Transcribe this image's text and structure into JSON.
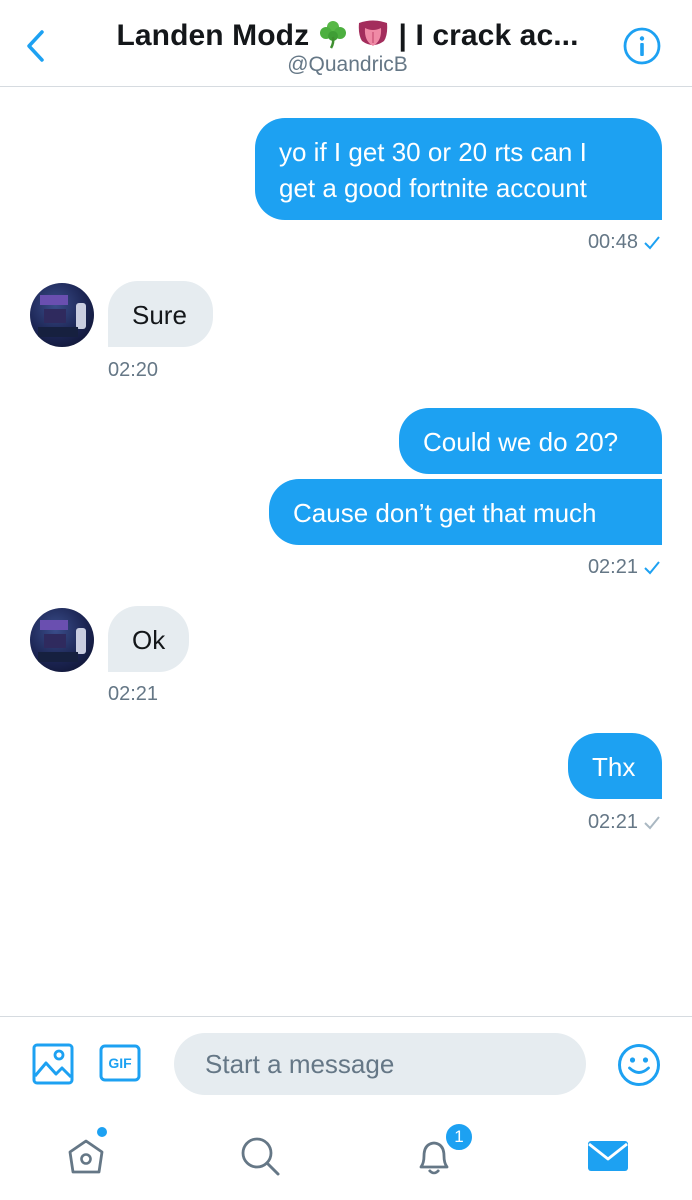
{
  "header": {
    "title": "Landen Modz",
    "title_suffix": "| I crack ac...",
    "emojis": [
      "shamrock-icon",
      "tongue-face-icon"
    ],
    "handle": "@QuandricB"
  },
  "messages": [
    {
      "text_lines": [
        "yo if I get 30 or 20 rts can I",
        "get a good fortnite account"
      ],
      "direction": "outgoing"
    },
    {
      "time": "00:48",
      "status": "read"
    },
    {
      "text": "Sure",
      "direction": "incoming"
    },
    {
      "time": "02:20"
    },
    {
      "text": "Could we do 20?",
      "direction": "outgoing"
    },
    {
      "text": "Cause don’t get that much",
      "direction": "outgoing"
    },
    {
      "time": "02:21",
      "status": "read"
    },
    {
      "text": "Ok",
      "direction": "incoming"
    },
    {
      "time": "02:21"
    },
    {
      "text": "Thx",
      "direction": "outgoing"
    },
    {
      "time": "02:21",
      "status": "sent"
    }
  ],
  "composer": {
    "placeholder": "Start a message",
    "gif_label": "GIF"
  },
  "tabbar": {
    "notifications_badge": "1"
  },
  "colors": {
    "accent": "#1da1f2",
    "incoming_bubble": "#e6ecf0",
    "secondary_text": "#657786",
    "sent_check": "#aab8c2"
  }
}
